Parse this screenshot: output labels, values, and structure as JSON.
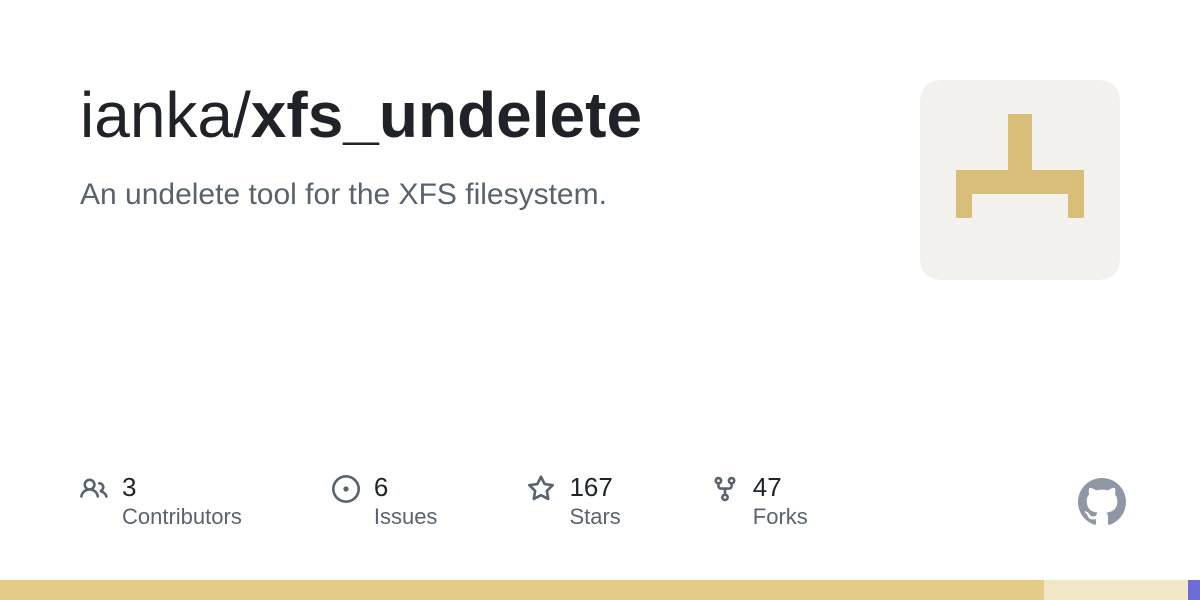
{
  "repo": {
    "owner": "ianka",
    "name": "xfs_undelete",
    "description": "An undelete tool for the XFS filesystem."
  },
  "stats": {
    "contributors": {
      "count": "3",
      "label": "Contributors"
    },
    "issues": {
      "count": "6",
      "label": "Issues"
    },
    "stars": {
      "count": "167",
      "label": "Stars"
    },
    "forks": {
      "count": "47",
      "label": "Forks"
    }
  },
  "languages": [
    {
      "color": "#e4cb87",
      "percent": 87
    },
    {
      "color": "#f2e7c5",
      "percent": 12
    },
    {
      "color": "#6f6bd8",
      "percent": 1
    }
  ],
  "avatar": {
    "shape_color": "#d8be78",
    "bg": "#f3f1ed"
  }
}
